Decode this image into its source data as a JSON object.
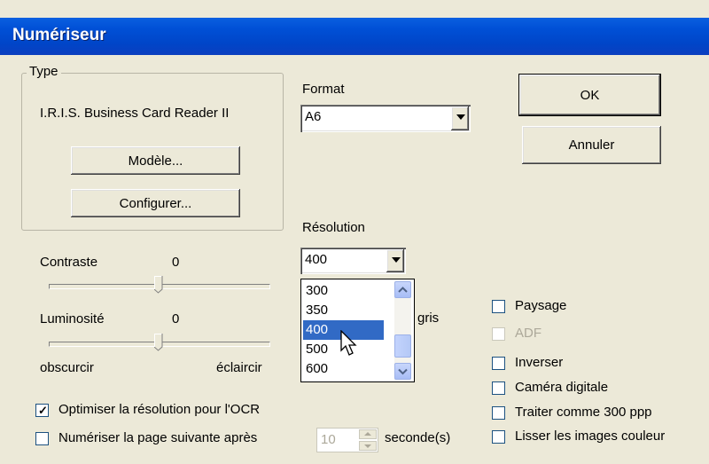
{
  "window": {
    "title": "Numériseur"
  },
  "type_group": {
    "legend": "Type",
    "device_name": "I.R.I.S. Business Card Reader II",
    "model_button": "Modèle...",
    "configure_button": "Configurer..."
  },
  "format": {
    "label": "Format",
    "value": "A6"
  },
  "buttons": {
    "ok": "OK",
    "cancel": "Annuler"
  },
  "resolution": {
    "label": "Résolution",
    "value": "400",
    "options": [
      "300",
      "350",
      "400",
      "500",
      "600"
    ],
    "highlighted": "400"
  },
  "contrast": {
    "label": "Contraste",
    "value": "0",
    "level": 0.5
  },
  "brightness": {
    "label": "Luminosité",
    "value": "0",
    "level": 0.5
  },
  "brightness_range": {
    "min_label": "obscurcir",
    "max_label": "éclaircir"
  },
  "partial_label": "gris",
  "options": [
    {
      "label": "Paysage",
      "checked": false,
      "enabled": true
    },
    {
      "label": "ADF",
      "checked": false,
      "enabled": false
    },
    {
      "label": "Inverser",
      "checked": false,
      "enabled": true
    },
    {
      "label": "Caméra digitale",
      "checked": false,
      "enabled": true
    },
    {
      "label": "Traiter comme 300 ppp",
      "checked": false,
      "enabled": true
    },
    {
      "label": "Lisser les images couleur",
      "checked": false,
      "enabled": true
    }
  ],
  "ocr_option": {
    "label": "Optimiser la résolution pour l'OCR",
    "checked": true
  },
  "next_page": {
    "label": "Numériser la page suivante après",
    "checked": false,
    "seconds": "10",
    "unit": "seconde(s)"
  },
  "icons": {
    "combo_arrow": "chevron-down-icon",
    "scroll_up": "arrow-up-icon",
    "scroll_down": "arrow-down-icon",
    "cursor": "mouse-pointer-icon"
  }
}
